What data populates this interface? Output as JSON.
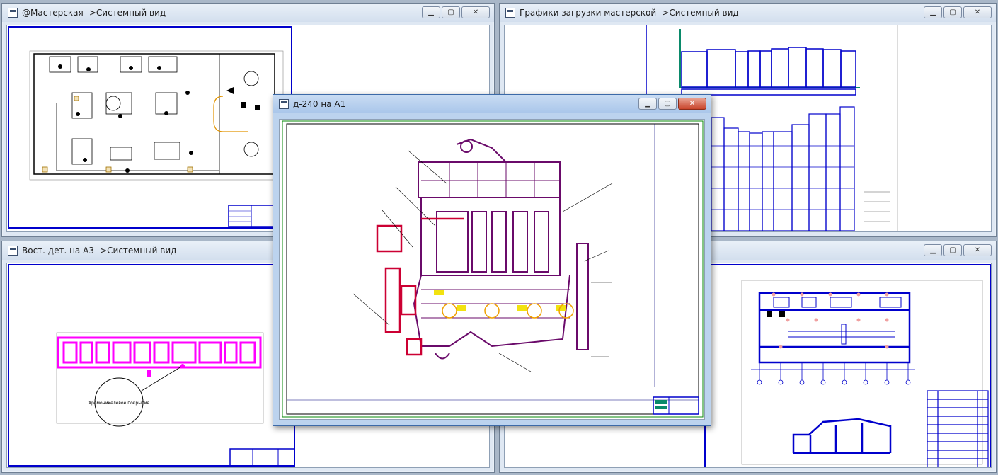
{
  "windows": {
    "workshop": {
      "title": "@Мастерская ->Системный вид"
    },
    "load_charts": {
      "title": "Графики загрузки мастерской ->Системный вид"
    },
    "restored_part": {
      "title": "Вост. дет. на А3 ->Системный вид",
      "label": "Хромоникелевое покрытие"
    },
    "engine": {
      "title": "д-240 на А1"
    },
    "building": {
      "title": ""
    }
  },
  "window_controls": {
    "minimize": "▁",
    "maximize": "▢",
    "close": "✕"
  },
  "colors": {
    "frame_blue": "#0000cc",
    "drawing_purple": "#6a0a6a",
    "magenta": "#ff00ff",
    "crimson": "#cc0033"
  }
}
